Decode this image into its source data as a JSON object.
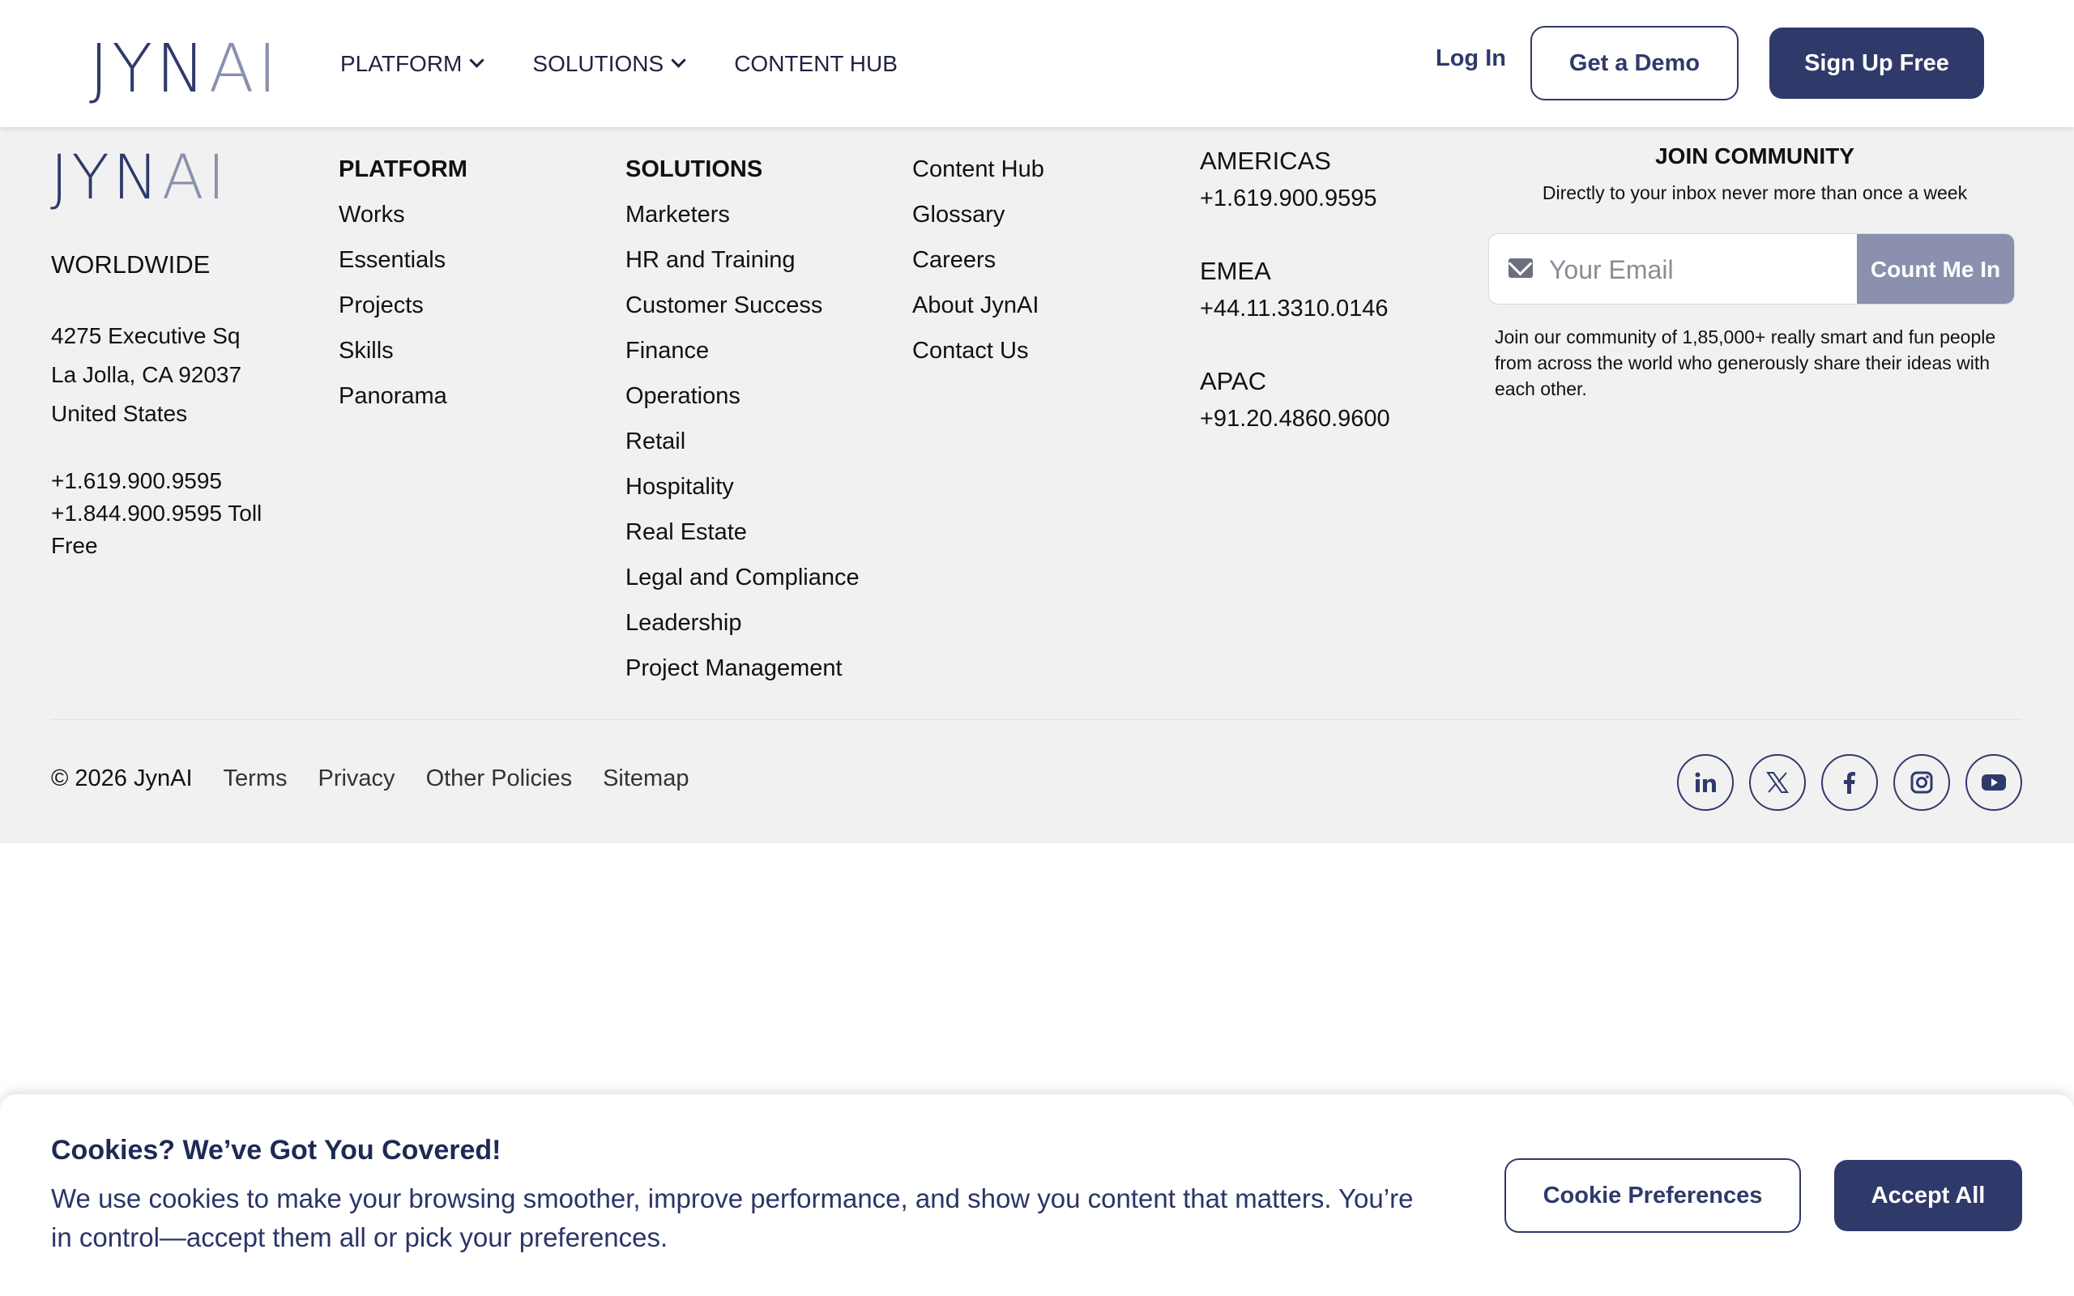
{
  "header": {
    "logo": {
      "main": "JYN",
      "accent": "AI"
    },
    "nav": [
      {
        "label": "PLATFORM",
        "has_dropdown": true
      },
      {
        "label": "SOLUTIONS",
        "has_dropdown": true
      },
      {
        "label": "CONTENT HUB",
        "has_dropdown": false
      }
    ],
    "login_label": "Log In",
    "demo_label": "Get a Demo",
    "signup_label": "Sign Up Free"
  },
  "footer": {
    "logo": {
      "main": "JYN",
      "accent": "AI"
    },
    "worldwide": "WORLDWIDE",
    "address": [
      "4275 Executive Sq",
      "La Jolla, CA 92037",
      "United States"
    ],
    "phone_main": "+1.619.900.9595",
    "phone_tollfree": "+1.844.900.9595 Toll Free",
    "platform": {
      "heading": "PLATFORM",
      "items": [
        "Works",
        "Essentials",
        "Projects",
        "Skills",
        "Panorama"
      ]
    },
    "solutions": {
      "heading": "SOLUTIONS",
      "items": [
        "Marketers",
        "HR and Training",
        "Customer Success",
        "Finance",
        "Operations",
        "Retail",
        "Hospitality",
        "Real Estate",
        "Legal and Compliance",
        "Leadership",
        "Project Management"
      ]
    },
    "company": {
      "items": [
        "Content Hub",
        "Glossary",
        "Careers",
        "About JynAI",
        "Contact Us"
      ]
    },
    "regions": [
      {
        "name": "AMERICAS",
        "phone": "+1.619.900.9595"
      },
      {
        "name": "EMEA",
        "phone": "+44.11.3310.0146"
      },
      {
        "name": "APAC",
        "phone": "+91.20.4860.9600"
      }
    ],
    "community": {
      "title": "JOIN COMMUNITY",
      "subtitle": "Directly to your inbox never more than once a week",
      "email_placeholder": "Your Email",
      "button_label": "Count Me In",
      "description": "Join our community of 1,85,000+ really smart and fun people from across the world who generously share their ideas with each other."
    },
    "copyright": "© 2026 JynAI",
    "bottom_links": [
      "Terms",
      "Privacy",
      "Other Policies",
      "Sitemap"
    ],
    "socials": [
      "linkedin-icon",
      "x-icon",
      "facebook-icon",
      "instagram-icon",
      "youtube-icon"
    ]
  },
  "cookie": {
    "title": "Cookies? We’ve Got You Covered!",
    "body": "We use cookies to make your browsing smoother, improve performance, and show you content that matters. You’re in control—accept them all or pick your preferences.",
    "preferences_label": "Cookie Preferences",
    "accept_label": "Accept All"
  },
  "colors": {
    "brand": "#2f3a6b",
    "accent": "#8a90ad",
    "footer_bg": "#f1f1f1"
  }
}
